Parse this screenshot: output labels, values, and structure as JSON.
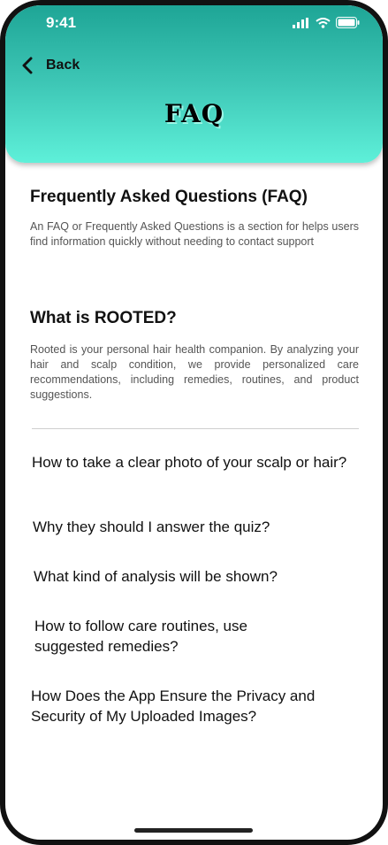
{
  "status_bar": {
    "time": "9:41"
  },
  "header": {
    "back_label": "Back",
    "title": "FAQ"
  },
  "intro": {
    "heading": "Frequently Asked Questions (FAQ)",
    "text": "An FAQ or Frequently Asked Questions is a section for helps users find information quickly without needing to contact support"
  },
  "about": {
    "heading": "What is ROOTED?",
    "text": "Rooted is your personal hair health companion. By analyzing your hair and scalp condition, we provide personalized care recommendations, including remedies, routines, and product suggestions."
  },
  "questions": [
    "How to take a clear photo of your scalp or hair?",
    "Why they should I answer the quiz?",
    "What kind of analysis will be shown?",
    "How to follow care routines, use suggested remedies?",
    "How Does the App Ensure the Privacy and Security of My Uploaded Images?"
  ],
  "colors": {
    "header_top": "#1ea596",
    "header_bottom": "#5ef0d9"
  }
}
